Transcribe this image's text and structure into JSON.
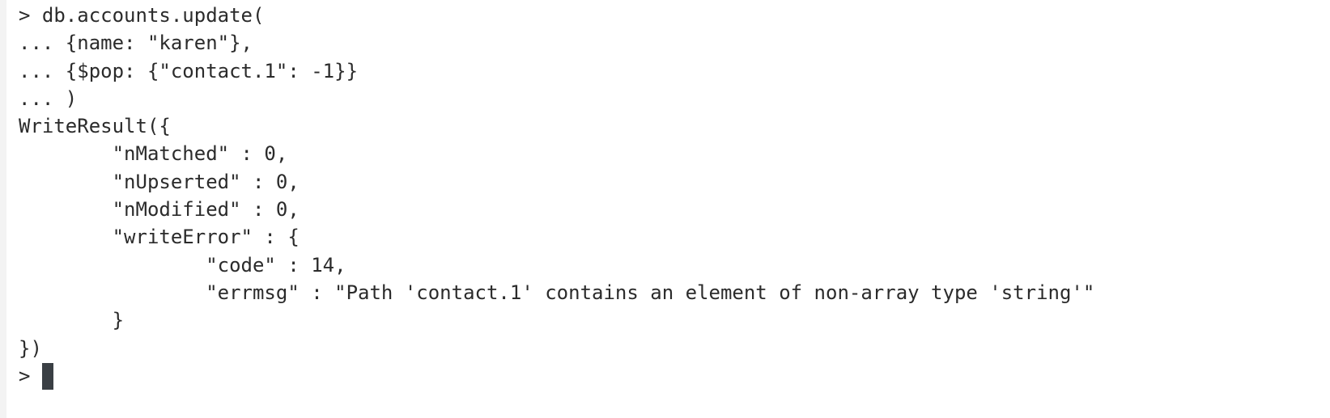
{
  "terminal": {
    "lines": [
      "> db.accounts.update(",
      "... {name: \"karen\"},",
      "... {$pop: {\"contact.1\": -1}}",
      "... )",
      "WriteResult({",
      "        \"nMatched\" : 0,",
      "        \"nUpserted\" : 0,",
      "        \"nModified\" : 0,",
      "        \"writeError\" : {",
      "                \"code\" : 14,",
      "                \"errmsg\" : \"Path 'contact.1' contains an element of non-array type 'string'\"",
      "        }",
      "})"
    ],
    "prompt": "> "
  }
}
